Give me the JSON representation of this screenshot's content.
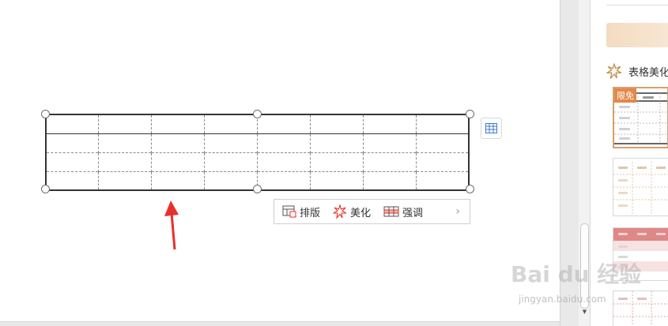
{
  "float_toolbar": {
    "layout_label": "排版",
    "beautify_label": "美化",
    "emphasize_label": "强调",
    "more_glyph": "›"
  },
  "right_panel": {
    "heading": "表格美化",
    "free_badge": "限免"
  },
  "watermark": {
    "brand": "Bai du 经验",
    "url": "jingyan.baidu.com"
  },
  "colors": {
    "accent_orange": "#e2884a",
    "arrow_red": "#e8302b",
    "selected_border": "#d7a06a"
  }
}
